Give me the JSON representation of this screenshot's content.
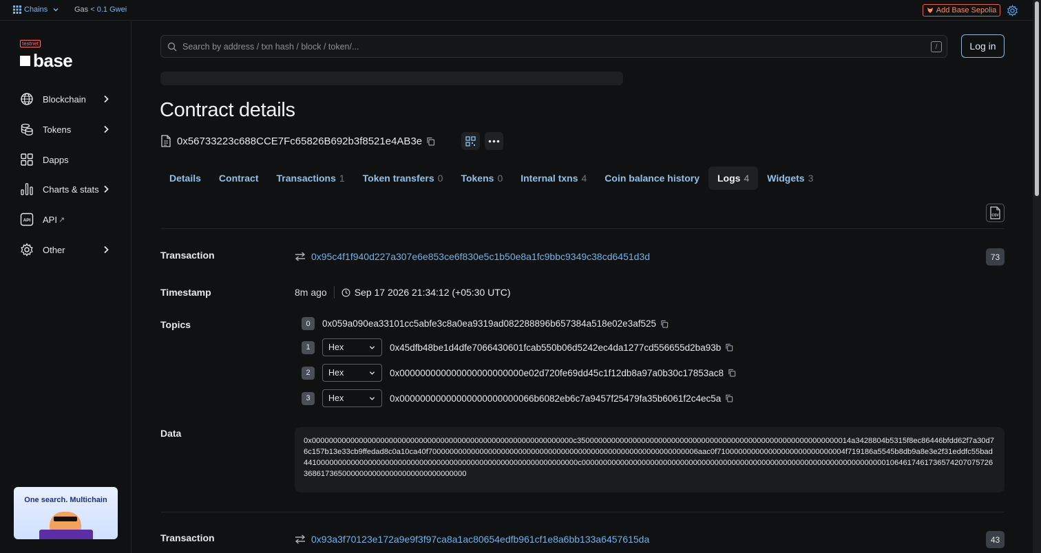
{
  "topbar": {
    "chains_label": "Chains",
    "gas_label": "Gas",
    "gas_value": "< 0.1 Gwei",
    "add_network_label": "Add Base Sepolia"
  },
  "sidebar": {
    "testnet_badge": "testnet",
    "logo_text": "base",
    "items": [
      {
        "label": "Blockchain",
        "icon": "globe-icon",
        "has_submenu": true
      },
      {
        "label": "Tokens",
        "icon": "tokens-icon",
        "has_submenu": true
      },
      {
        "label": "Dapps",
        "icon": "grid-icon",
        "has_submenu": false
      },
      {
        "label": "Charts & stats",
        "icon": "chart-icon",
        "has_submenu": true
      },
      {
        "label": "API",
        "icon": "api-icon",
        "has_submenu": false,
        "external": "↗"
      },
      {
        "label": "Other",
        "icon": "gear-icon",
        "has_submenu": true
      }
    ],
    "promo_text": "One search. Multichain"
  },
  "search": {
    "placeholder": "Search by address / txn hash / block / token/...",
    "shortcut": "/"
  },
  "login_label": "Log in",
  "page": {
    "title": "Contract details",
    "address": "0x56733223c688CCE7Fc65826B692b3f8521e4AB3e"
  },
  "tabs": [
    {
      "label": "Details",
      "count": ""
    },
    {
      "label": "Contract",
      "count": ""
    },
    {
      "label": "Transactions",
      "count": "1"
    },
    {
      "label": "Token transfers",
      "count": "0"
    },
    {
      "label": "Tokens",
      "count": "0"
    },
    {
      "label": "Internal txns",
      "count": "4"
    },
    {
      "label": "Coin balance history",
      "count": ""
    },
    {
      "label": "Logs",
      "count": "4",
      "active": true
    },
    {
      "label": "Widgets",
      "count": "3"
    }
  ],
  "logs": [
    {
      "transaction_label": "Transaction",
      "transaction_hash": "0x95c4f1f940d227a307e6e853ce6f830e5c1b50e8a1fc9bbc9349c38cd6451d3d",
      "log_index": "73",
      "timestamp_label": "Timestamp",
      "timestamp_ago": "8m ago",
      "timestamp_full": "Sep 17 2026 21:34:12 (+05:30 UTC)",
      "topics_label": "Topics",
      "topics": [
        {
          "index": "0",
          "format": "",
          "value": "0x059a090ea33101cc5abfe3c8a0ea9319ad082288896b657384a518e02e3af525"
        },
        {
          "index": "1",
          "format": "Hex",
          "value": "0x45dfb48be1d4dfe7066430601fcab550b06d5242ec4da1277cd556655d2ba93b"
        },
        {
          "index": "2",
          "format": "Hex",
          "value": "0x000000000000000000000000e02d720fe69dd45c1f12db8a97a0b30c17853ac8"
        },
        {
          "index": "3",
          "format": "Hex",
          "value": "0x00000000000000000000000066b6082eb6c7a9457f25479fa35b6061f2c4ec5a"
        }
      ],
      "data_label": "Data",
      "data": "0x0000000000000000000000000000000000000000000000000000000000000c3500000000000000000000000000000000000000000000000000000000000014a3428804b5315f8ec86446bfdd62f7a30d76c157b13e33cb9ffedad8c0a10ca40f700000000000000000000000000000000000000000000000000000000000006aac0f710000000000000000000000000004f719186a5545b8db9a8e3e2f31eddfc55bad4410000000000000000000000000000000000000000000000000000000000000c00000000000000000000000000000000000000000000000000000000000000000000000106461746173657420707572636861736500000000000000000000000000000"
    },
    {
      "transaction_label": "Transaction",
      "transaction_hash": "0x93a3f70123e172a9e9f3f97ca8a1ac80654edfb961cf1e8a6bb133a6457615da",
      "log_index": "43"
    }
  ],
  "colors": {
    "background": "#101112",
    "link": "#6fb3ea",
    "accent_orange": "#e3643b"
  }
}
